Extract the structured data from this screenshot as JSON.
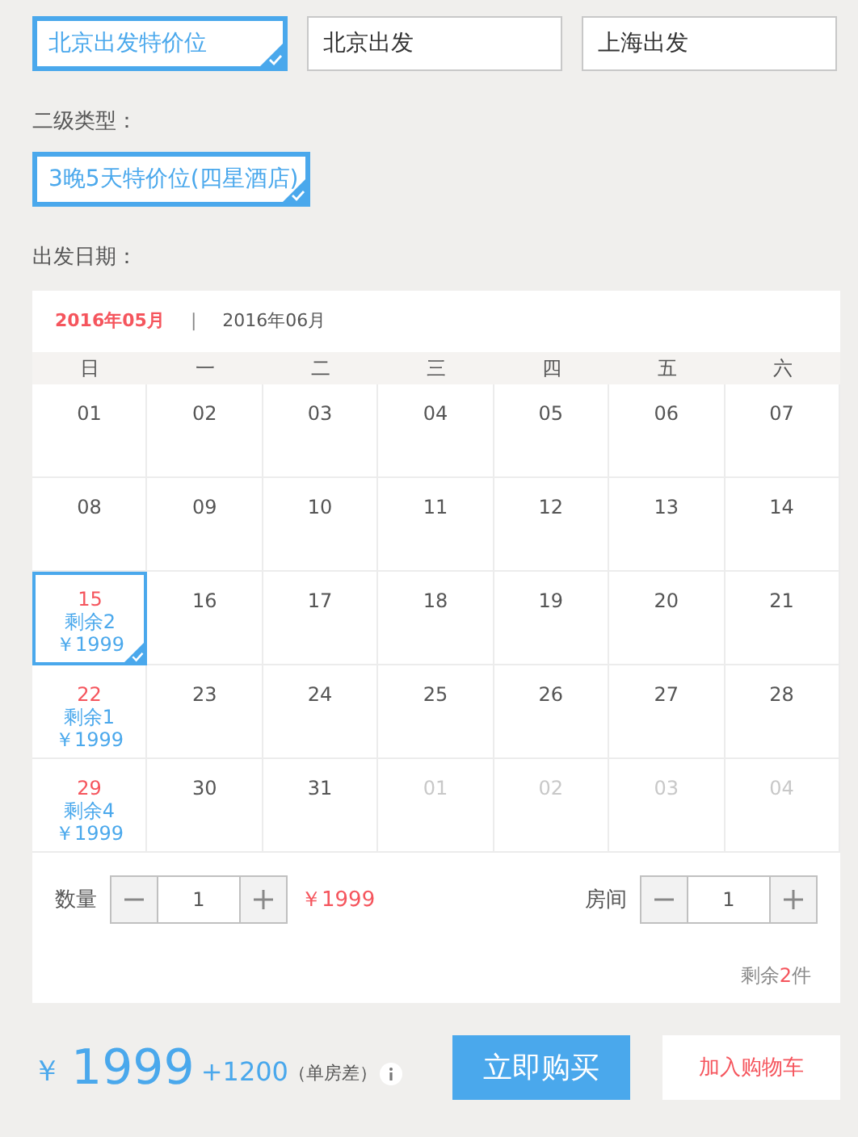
{
  "options": [
    {
      "label": "北京出发特价位",
      "selected": true
    },
    {
      "label": "北京出发",
      "selected": false
    },
    {
      "label": "上海出发",
      "selected": false
    }
  ],
  "subtype_label": "二级类型：",
  "subtypes": [
    {
      "label": "3晚5天特价位(四星酒店)",
      "selected": true
    }
  ],
  "date_label": "出发日期：",
  "calendar": {
    "months": [
      {
        "label": "2016年05月",
        "selected": true
      },
      {
        "label": "2016年06月",
        "selected": false
      }
    ],
    "separator": "|",
    "weekdays": [
      "日",
      "一",
      "二",
      "三",
      "四",
      "五",
      "六"
    ],
    "weeks": [
      [
        {
          "date": "01",
          "muted": false,
          "selected": false
        },
        {
          "date": "02",
          "muted": false,
          "selected": false
        },
        {
          "date": "03",
          "muted": false,
          "selected": false
        },
        {
          "date": "04",
          "muted": false,
          "selected": false
        },
        {
          "date": "05",
          "muted": false,
          "selected": false
        },
        {
          "date": "06",
          "muted": false,
          "selected": false
        },
        {
          "date": "07",
          "muted": false,
          "selected": false
        }
      ],
      [
        {
          "date": "08",
          "muted": false,
          "selected": false
        },
        {
          "date": "09",
          "muted": false,
          "selected": false
        },
        {
          "date": "10",
          "muted": false,
          "selected": false
        },
        {
          "date": "11",
          "muted": false,
          "selected": false
        },
        {
          "date": "12",
          "muted": false,
          "selected": false
        },
        {
          "date": "13",
          "muted": false,
          "selected": false
        },
        {
          "date": "14",
          "muted": false,
          "selected": false
        }
      ],
      [
        {
          "date": "15",
          "muted": false,
          "selected": true,
          "stock": "剩余2",
          "price": "￥1999"
        },
        {
          "date": "16",
          "muted": false,
          "selected": false
        },
        {
          "date": "17",
          "muted": false,
          "selected": false
        },
        {
          "date": "18",
          "muted": false,
          "selected": false
        },
        {
          "date": "19",
          "muted": false,
          "selected": false
        },
        {
          "date": "20",
          "muted": false,
          "selected": false
        },
        {
          "date": "21",
          "muted": false,
          "selected": false
        }
      ],
      [
        {
          "date": "22",
          "muted": false,
          "selected": false,
          "stock": "剩余1",
          "price": "￥1999"
        },
        {
          "date": "23",
          "muted": false,
          "selected": false
        },
        {
          "date": "24",
          "muted": false,
          "selected": false
        },
        {
          "date": "25",
          "muted": false,
          "selected": false
        },
        {
          "date": "26",
          "muted": false,
          "selected": false
        },
        {
          "date": "27",
          "muted": false,
          "selected": false
        },
        {
          "date": "28",
          "muted": false,
          "selected": false
        }
      ],
      [
        {
          "date": "29",
          "muted": false,
          "selected": false,
          "stock": "剩余4",
          "price": "￥1999"
        },
        {
          "date": "30",
          "muted": false,
          "selected": false
        },
        {
          "date": "31",
          "muted": false,
          "selected": false
        },
        {
          "date": "01",
          "muted": true,
          "selected": false
        },
        {
          "date": "02",
          "muted": true,
          "selected": false
        },
        {
          "date": "03",
          "muted": true,
          "selected": false
        },
        {
          "date": "04",
          "muted": true,
          "selected": false
        }
      ]
    ]
  },
  "quantity": {
    "label": "数量",
    "value": "1",
    "price": "￥1999"
  },
  "rooms": {
    "label": "房间",
    "value": "1"
  },
  "remaining": {
    "prefix": "剩余",
    "count": "2",
    "suffix": "件"
  },
  "total": {
    "currency": "￥",
    "amount": "1999",
    "extra": "+1200",
    "note": "（单房差）"
  },
  "buttons": {
    "buy": "立即购买",
    "cart": "加入购物车"
  }
}
